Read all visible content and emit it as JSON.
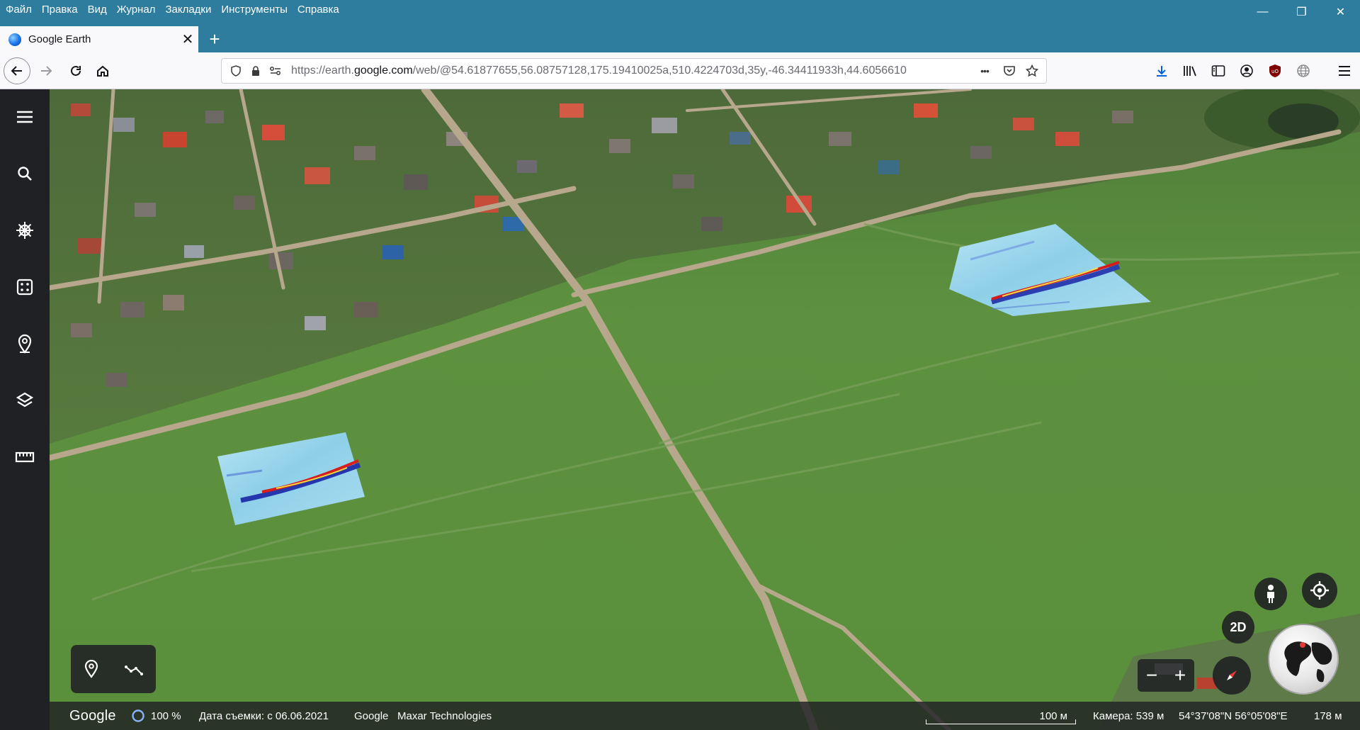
{
  "menubar": {
    "items": [
      "Файл",
      "Правка",
      "Вид",
      "Журнал",
      "Закладки",
      "Инструменты",
      "Справка"
    ]
  },
  "window_controls": {
    "minimize": "—",
    "restore": "❐",
    "close": "✕"
  },
  "tab": {
    "title": "Google Earth",
    "close": "✕",
    "new_tab": "+"
  },
  "urlbar": {
    "prefix": "https://earth.",
    "host": "google.com",
    "path": "/web/@54.61877655,56.08757128,175.19410025a,510.4224703d,35y,-46.34411933h,44.6056610",
    "more": "•••"
  },
  "toolbar_icons": [
    "download-icon",
    "library-icon",
    "sidebar-icon",
    "account-icon",
    "ublock-icon",
    "globe-icon",
    "menu-icon"
  ],
  "left_rail": [
    "menu-icon",
    "search-icon",
    "voyager-icon",
    "feeling-lucky-icon",
    "projects-icon",
    "map-style-icon",
    "measure-icon"
  ],
  "map_controls": {
    "view_mode": "2D",
    "zoom_out": "−",
    "zoom_in": "+"
  },
  "statusbar": {
    "logo": "Google",
    "loading_percent": "100 %",
    "imagery_date": "Дата съемки: с 06.06.2021",
    "attribution_google": "Google",
    "attribution_maxar": "Maxar Technologies",
    "scale_label": "100 м",
    "camera": "Камера: 539 м",
    "coordinates": "54°37'08\"N 56°05'08\"E",
    "elevation": "178 м"
  },
  "colors": {
    "browser_chrome": "#2f7d9e",
    "earth_rail": "#202124",
    "grass": "#5f8f3e"
  }
}
